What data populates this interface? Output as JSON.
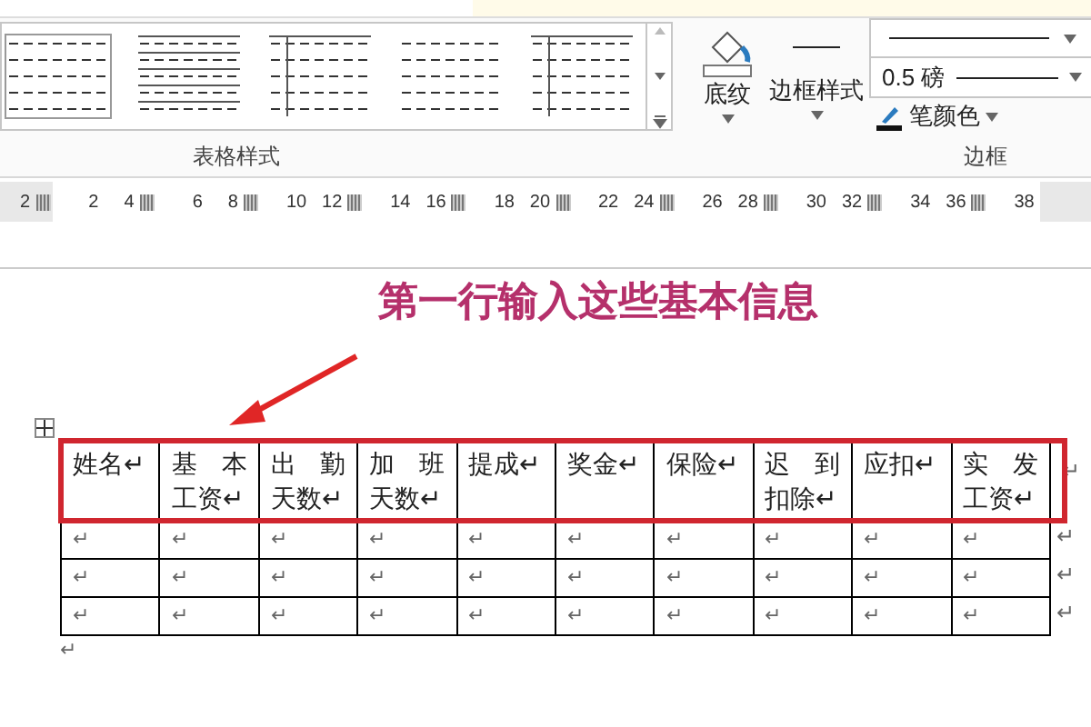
{
  "ribbon": {
    "groups": [
      {
        "label": "表格样式"
      },
      {
        "label": "边框"
      }
    ],
    "shading_button": {
      "label": "底纹"
    },
    "border_styles_button": {
      "label": "边框样式"
    },
    "line_weight": {
      "value": "0.5 磅"
    },
    "pen_color": {
      "label": "笔颜色"
    }
  },
  "ruler": {
    "labels": [
      "2",
      "2",
      "4",
      "6",
      "8",
      "10",
      "12",
      "14",
      "16",
      "18",
      "20",
      "22",
      "24",
      "26",
      "28",
      "30",
      "32",
      "34",
      "36",
      "38"
    ]
  },
  "annotation": {
    "text": "第一行输入这些基本信息"
  },
  "table": {
    "header": [
      {
        "lines": [
          "姓名↵"
        ]
      },
      {
        "lines": [
          "基 本",
          "工资↵"
        ]
      },
      {
        "lines": [
          "出 勤",
          "天数↵"
        ]
      },
      {
        "lines": [
          "加 班",
          "天数↵"
        ]
      },
      {
        "lines": [
          "提成↵"
        ]
      },
      {
        "lines": [
          "奖金↵"
        ]
      },
      {
        "lines": [
          "保险↵"
        ]
      },
      {
        "lines": [
          "迟 到",
          "扣除↵"
        ]
      },
      {
        "lines": [
          "应扣↵"
        ]
      },
      {
        "lines": [
          "实 发",
          "工资↵"
        ]
      }
    ],
    "header_row_end": "↵",
    "rows": [
      {
        "cells": [
          "↵",
          "↵",
          "↵",
          "↵",
          "↵",
          "↵",
          "↵",
          "↵",
          "↵",
          "↵"
        ],
        "row_end": "↵"
      },
      {
        "cells": [
          "↵",
          "↵",
          "↵",
          "↵",
          "↵",
          "↵",
          "↵",
          "↵",
          "↵",
          "↵"
        ],
        "row_end": "↵"
      },
      {
        "cells": [
          "↵",
          "↵",
          "↵",
          "↵",
          "↵",
          "↵",
          "↵",
          "↵",
          "↵",
          "↵"
        ],
        "row_end": "↵"
      }
    ]
  },
  "after_table": "↵"
}
